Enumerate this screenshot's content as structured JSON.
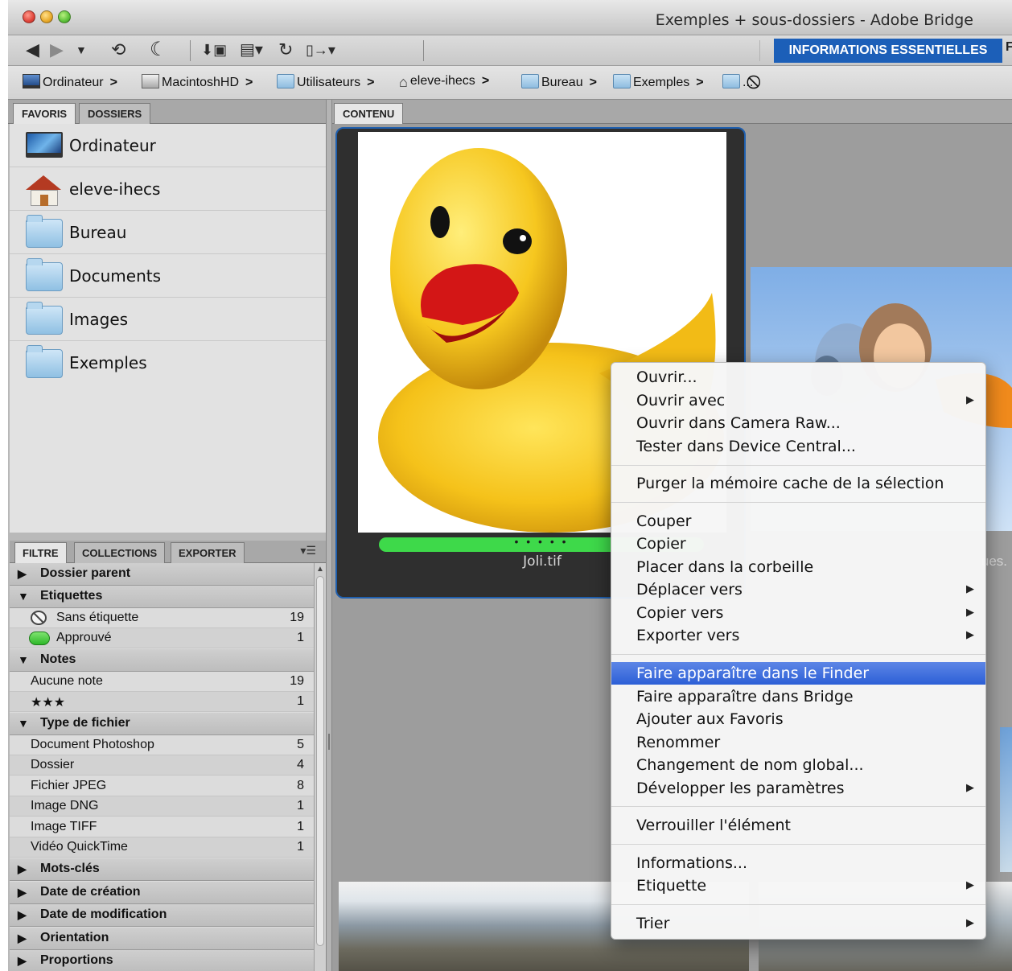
{
  "window": {
    "title": "Exemples + sous-dossiers - Adobe Bridge"
  },
  "toolbar": {
    "workspace_active": "INFORMATIONS ESSENTIELLES",
    "workspace_next": "F",
    "icons": [
      "back-arrow-icon",
      "forward-arrow-icon",
      "recent-dropdown-icon",
      "reveal-recent-icon",
      "return-icon",
      "camera-import-icon",
      "refine-icon",
      "rotate-icon",
      "output-icon"
    ]
  },
  "pathbar": {
    "crumbs": [
      {
        "label": "Ordinateur",
        "icon": "computer-icon"
      },
      {
        "label": "MacintoshHD",
        "icon": "disk-icon"
      },
      {
        "label": "Utilisateurs",
        "icon": "folder-icon"
      },
      {
        "label": "eleve-ihecs",
        "icon": "home-icon"
      },
      {
        "label": "Bureau",
        "icon": "folder-icon"
      },
      {
        "label": "Exemples",
        "icon": "folder-icon"
      },
      {
        "label": "...",
        "icon": "folder-icon"
      }
    ],
    "separator": ">",
    "stop_icon": "⃠"
  },
  "left_tabs": [
    "FAVORIS",
    "DOSSIERS"
  ],
  "favorites": [
    {
      "label": "Ordinateur",
      "icon": "monitor-icon"
    },
    {
      "label": "eleve-ihecs",
      "icon": "home-icon"
    },
    {
      "label": "Bureau",
      "icon": "folder-icon"
    },
    {
      "label": "Documents",
      "icon": "folder-icon"
    },
    {
      "label": "Images",
      "icon": "folder-icon"
    },
    {
      "label": "Exemples",
      "icon": "folder-icon"
    }
  ],
  "filter_tabs": [
    "FILTRE",
    "COLLECTIONS",
    "EXPORTER"
  ],
  "filter": {
    "dossier_parent": "Dossier parent",
    "etiquettes": "Etiquettes",
    "sans_etiquette": {
      "label": "Sans étiquette",
      "count": "19"
    },
    "approuve": {
      "label": "Approuvé",
      "count": "1"
    },
    "notes": "Notes",
    "aucune_note": {
      "label": "Aucune note",
      "count": "19"
    },
    "trois_etoiles": {
      "label": "★★★",
      "count": "1"
    },
    "type_fichier": "Type de fichier",
    "types": [
      {
        "label": "Document Photoshop",
        "count": "5"
      },
      {
        "label": "Dossier",
        "count": "4"
      },
      {
        "label": "Fichier JPEG",
        "count": "8"
      },
      {
        "label": "Image DNG",
        "count": "1"
      },
      {
        "label": "Image TIFF",
        "count": "1"
      },
      {
        "label": "Vidéo QuickTime",
        "count": "1"
      }
    ],
    "mots_cles": "Mots-clés",
    "date_creation": "Date de création",
    "date_modification": "Date de modification",
    "orientation": "Orientation",
    "proportions": "Proportions"
  },
  "content": {
    "tab": "CONTENU",
    "thumb1": {
      "name": "Joli.tif",
      "rating_dots": "• • • • •"
    },
    "thumb2": {
      "name_fragment": "ues."
    }
  },
  "context_menu": {
    "items": [
      {
        "label": "Ouvrir...",
        "submenu": false
      },
      {
        "label": "Ouvrir avec",
        "submenu": true
      },
      {
        "label": "Ouvrir dans Camera Raw...",
        "submenu": false
      },
      {
        "label": "Tester dans Device Central...",
        "submenu": false
      },
      {
        "label": "Purger la mémoire cache de la sélection",
        "submenu": false
      },
      {
        "label": "Couper",
        "submenu": false
      },
      {
        "label": "Copier",
        "submenu": false
      },
      {
        "label": "Placer dans la corbeille",
        "submenu": false
      },
      {
        "label": "Déplacer vers",
        "submenu": true
      },
      {
        "label": "Copier vers",
        "submenu": true
      },
      {
        "label": "Exporter vers",
        "submenu": true
      },
      {
        "label": "Faire apparaître dans le Finder",
        "submenu": false,
        "highlighted": true
      },
      {
        "label": "Faire apparaître dans Bridge",
        "submenu": false
      },
      {
        "label": "Ajouter aux Favoris",
        "submenu": false
      },
      {
        "label": "Renommer",
        "submenu": false
      },
      {
        "label": "Changement de nom global...",
        "submenu": false
      },
      {
        "label": "Développer les paramètres",
        "submenu": true
      },
      {
        "label": "Verrouiller l'élément",
        "submenu": false
      },
      {
        "label": "Informations...",
        "submenu": false
      },
      {
        "label": "Etiquette",
        "submenu": true
      },
      {
        "label": "Trier",
        "submenu": true
      }
    ]
  },
  "colors": {
    "accent": "#1c5fb8",
    "highlight": "#3366dd",
    "rating_green": "#3ed94a",
    "panel_bg": "#e2e2e2",
    "content_bg": "#9d9d9d"
  }
}
